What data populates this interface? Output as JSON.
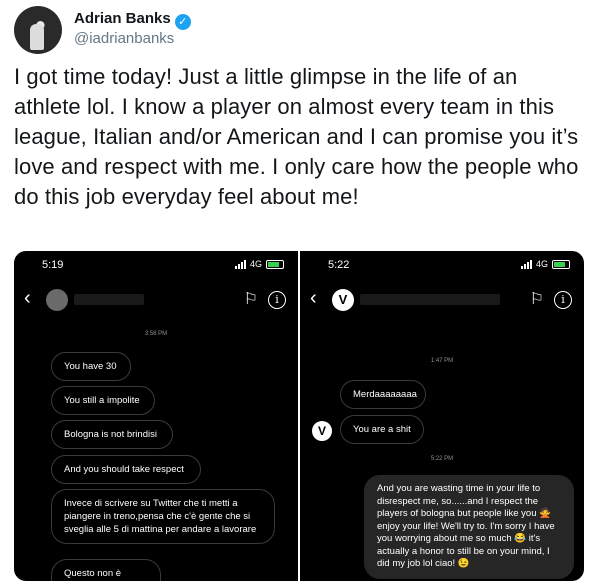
{
  "tweet": {
    "author_name": "Adrian Banks",
    "handle": "@iadrianbanks",
    "text": "I got time today! Just a little glimpse in the life of an athlete lol. I know a player on almost every team in this league, Italian and/or American and I can promise you it’s love and respect with me. I only care how the people who do this job everyday feel about me!"
  },
  "icons": {
    "verified": "verified-badge-icon",
    "back": "back-arrow-icon",
    "flag": "flag-icon",
    "info": "info-icon",
    "signal": "signal-icon",
    "battery": "battery-icon"
  },
  "colors": {
    "verified_blue": "#1da1f2",
    "handle_gray": "#657786",
    "screenshot_bg": "#000000",
    "battery_green": "#3ccf4e"
  },
  "screenshot_left": {
    "time": "5:19",
    "network": "4G",
    "timestamp": "3:58 PM",
    "messages": [
      "You have 30",
      "You still a impolite",
      "Bologna is not brindisi",
      "And you should take respect",
      "Invece di scrivere su Twitter che ti metti a piangere in treno,pensa che c'è gente che si sveglia alle 5 di mattina per andare a lavorare",
      "Questo non è sforzo??"
    ]
  },
  "screenshot_right": {
    "time": "5:22",
    "network": "4G",
    "logo_letter": "V",
    "timestamp_1": "1:47 PM",
    "messages_in": [
      "Merdaaaaaaaa",
      "You are a shit"
    ],
    "timestamp_2": "5:22 PM",
    "reply": "And you are wasting time in your life to disrespect me, so......and I respect the players of bologna but people like you 🙅 enjoy your life! We'll try to. I'm sorry I have you worrying about me so much 😂 it's actually a honor to still be on your mind, I did my job lol ciao! 😉"
  }
}
